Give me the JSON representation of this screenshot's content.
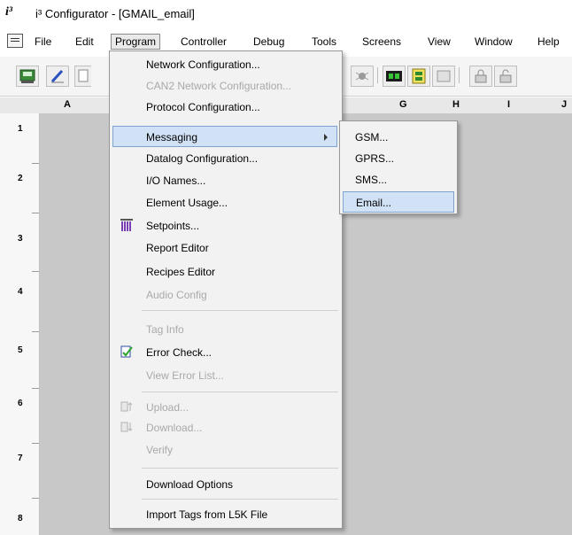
{
  "window": {
    "logo": "i³",
    "title": "i³ Configurator - [GMAIL_email]"
  },
  "menubar": {
    "items": [
      {
        "label": "File"
      },
      {
        "label": "Edit"
      },
      {
        "label": "Program"
      },
      {
        "label": "Controller"
      },
      {
        "label": "Debug"
      },
      {
        "label": "Tools"
      },
      {
        "label": "Screens"
      },
      {
        "label": "View"
      },
      {
        "label": "Window"
      },
      {
        "label": "Help"
      }
    ]
  },
  "grid": {
    "columns": [
      "A",
      "G",
      "H",
      "I",
      "J"
    ],
    "rows": [
      "1",
      "2",
      "3",
      "4",
      "5",
      "6",
      "7",
      "8"
    ]
  },
  "program_menu": {
    "items": [
      {
        "label": "Network Configuration...",
        "enabled": true
      },
      {
        "label": "CAN2 Network Configuration...",
        "enabled": false
      },
      {
        "label": "Protocol Configuration...",
        "enabled": true
      },
      {
        "label": "Messaging",
        "enabled": true
      },
      {
        "label": "Datalog Configuration...",
        "enabled": true
      },
      {
        "label": "I/O Names...",
        "enabled": true
      },
      {
        "label": "Element Usage...",
        "enabled": true
      },
      {
        "label": "Setpoints...",
        "enabled": true
      },
      {
        "label": "Report Editor",
        "enabled": true
      },
      {
        "label": "Recipes Editor",
        "enabled": true
      },
      {
        "label": "Audio Config",
        "enabled": false
      },
      {
        "label": "Tag Info",
        "enabled": false
      },
      {
        "label": "Error Check...",
        "enabled": true
      },
      {
        "label": "View Error List...",
        "enabled": false
      },
      {
        "label": "Upload...",
        "enabled": false
      },
      {
        "label": "Download...",
        "enabled": false
      },
      {
        "label": "Verify",
        "enabled": false
      },
      {
        "label": "Download Options",
        "enabled": true
      },
      {
        "label": "Import Tags from L5K File",
        "enabled": true
      }
    ]
  },
  "messaging_submenu": {
    "items": [
      {
        "label": "GSM..."
      },
      {
        "label": "GPRS..."
      },
      {
        "label": "SMS..."
      },
      {
        "label": "Email..."
      }
    ]
  },
  "colors": {
    "highlight": "#d1e2f6",
    "highlight_border": "#7da2ce",
    "menu_bg": "#f2f2f2",
    "grid_bg": "#c8c8c8",
    "disabled_text": "#a9a9a9"
  }
}
